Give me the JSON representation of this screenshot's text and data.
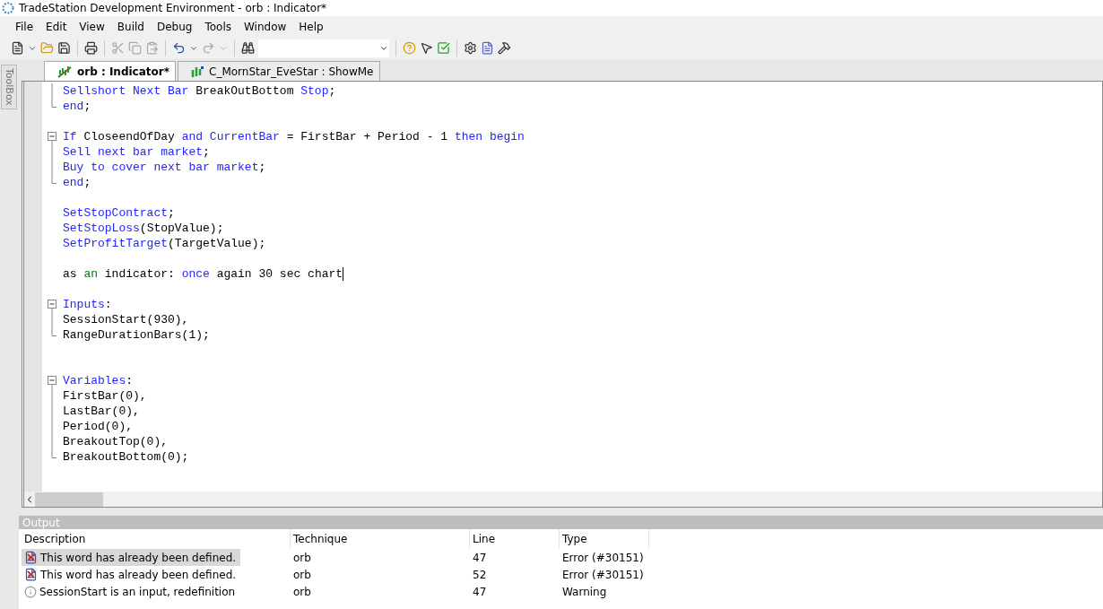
{
  "window": {
    "title": "TradeStation Development Environment - orb : Indicator*"
  },
  "menu": [
    "File",
    "Edit",
    "View",
    "Build",
    "Debug",
    "Tools",
    "Window",
    "Help"
  ],
  "toolbox": {
    "label": "ToolBox"
  },
  "tabs": [
    {
      "label": "orb : Indicator*",
      "selected": true
    },
    {
      "label": "C_MornStar_EveStar : ShowMe",
      "selected": false
    }
  ],
  "code": [
    {
      "kind": "fold-mid",
      "tokens": [
        {
          "kind": "keyword",
          "text": "Sellshort Next Bar "
        },
        {
          "kind": "plain",
          "text": "BreakOutBottom "
        },
        {
          "kind": "keyword",
          "text": "Stop"
        },
        {
          "kind": "plain",
          "text": ";"
        }
      ]
    },
    {
      "kind": "fold-end",
      "tokens": [
        {
          "kind": "keyword",
          "text": "end"
        },
        {
          "kind": "plain",
          "text": ";"
        }
      ]
    },
    {
      "kind": "blank"
    },
    {
      "kind": "fold-start",
      "tokens": [
        {
          "kind": "keyword",
          "text": "If "
        },
        {
          "kind": "plain",
          "text": "CloseendOfDay "
        },
        {
          "kind": "keyword",
          "text": "and CurrentBar "
        },
        {
          "kind": "plain",
          "text": "= FirstBar + Period - 1 "
        },
        {
          "kind": "keyword",
          "text": "then begin"
        }
      ]
    },
    {
      "kind": "fold-mid",
      "tokens": [
        {
          "kind": "keyword",
          "text": "Sell next bar market"
        },
        {
          "kind": "plain",
          "text": ";"
        }
      ]
    },
    {
      "kind": "fold-mid",
      "tokens": [
        {
          "kind": "keyword",
          "text": "Buy to cover next bar market"
        },
        {
          "kind": "plain",
          "text": ";"
        }
      ]
    },
    {
      "kind": "fold-end",
      "tokens": [
        {
          "kind": "keyword",
          "text": "end"
        },
        {
          "kind": "plain",
          "text": ";"
        }
      ]
    },
    {
      "kind": "blank"
    },
    {
      "kind": "code",
      "tokens": [
        {
          "kind": "keyword",
          "text": "SetStopContract"
        },
        {
          "kind": "plain",
          "text": ";"
        }
      ]
    },
    {
      "kind": "code",
      "tokens": [
        {
          "kind": "keyword",
          "text": "SetStopLoss"
        },
        {
          "kind": "plain",
          "text": "(StopValue);"
        }
      ]
    },
    {
      "kind": "code",
      "tokens": [
        {
          "kind": "keyword",
          "text": "SetProfitTarget"
        },
        {
          "kind": "plain",
          "text": "(TargetValue);"
        }
      ]
    },
    {
      "kind": "blank"
    },
    {
      "kind": "code",
      "cursor": true,
      "tokens": [
        {
          "kind": "plain",
          "text": "as "
        },
        {
          "kind": "green",
          "text": "an"
        },
        {
          "kind": "plain",
          "text": " indicator: "
        },
        {
          "kind": "keyword",
          "text": "once"
        },
        {
          "kind": "plain",
          "text": " again 30 sec chart"
        }
      ]
    },
    {
      "kind": "blank"
    },
    {
      "kind": "fold-start",
      "tokens": [
        {
          "kind": "keyword",
          "text": "Inputs"
        },
        {
          "kind": "plain",
          "text": ":"
        }
      ]
    },
    {
      "kind": "fold-mid",
      "tokens": [
        {
          "kind": "plain",
          "text": "SessionStart(930),"
        }
      ]
    },
    {
      "kind": "fold-end",
      "tokens": [
        {
          "kind": "plain",
          "text": "RangeDurationBars(1);"
        }
      ]
    },
    {
      "kind": "blank"
    },
    {
      "kind": "blank"
    },
    {
      "kind": "fold-start",
      "tokens": [
        {
          "kind": "keyword",
          "text": "Variables"
        },
        {
          "kind": "plain",
          "text": ":"
        }
      ]
    },
    {
      "kind": "fold-mid",
      "tokens": [
        {
          "kind": "plain",
          "text": "FirstBar(0),"
        }
      ]
    },
    {
      "kind": "fold-mid",
      "tokens": [
        {
          "kind": "plain",
          "text": "LastBar(0),"
        }
      ]
    },
    {
      "kind": "fold-mid",
      "tokens": [
        {
          "kind": "plain",
          "text": "Period(0),"
        }
      ]
    },
    {
      "kind": "fold-mid",
      "tokens": [
        {
          "kind": "plain",
          "text": "BreakoutTop(0),"
        }
      ]
    },
    {
      "kind": "fold-end",
      "tokens": [
        {
          "kind": "plain",
          "text": "BreakoutBottom(0);"
        }
      ]
    }
  ],
  "output": {
    "title": "Output",
    "columns": [
      "Description",
      "Technique",
      "Line",
      "Type"
    ],
    "rows": [
      {
        "kind": "error",
        "selected": true,
        "description": "This word has already been defined.",
        "technique": "orb",
        "line": "47",
        "type": "Error (#30151)"
      },
      {
        "kind": "error",
        "selected": false,
        "description": "This word has already been defined.",
        "technique": "orb",
        "line": "52",
        "type": "Error (#30151)"
      },
      {
        "kind": "warning",
        "selected": false,
        "description": "SessionStart is an input, redefinition",
        "technique": "orb",
        "line": "47",
        "type": "Warning"
      }
    ]
  }
}
